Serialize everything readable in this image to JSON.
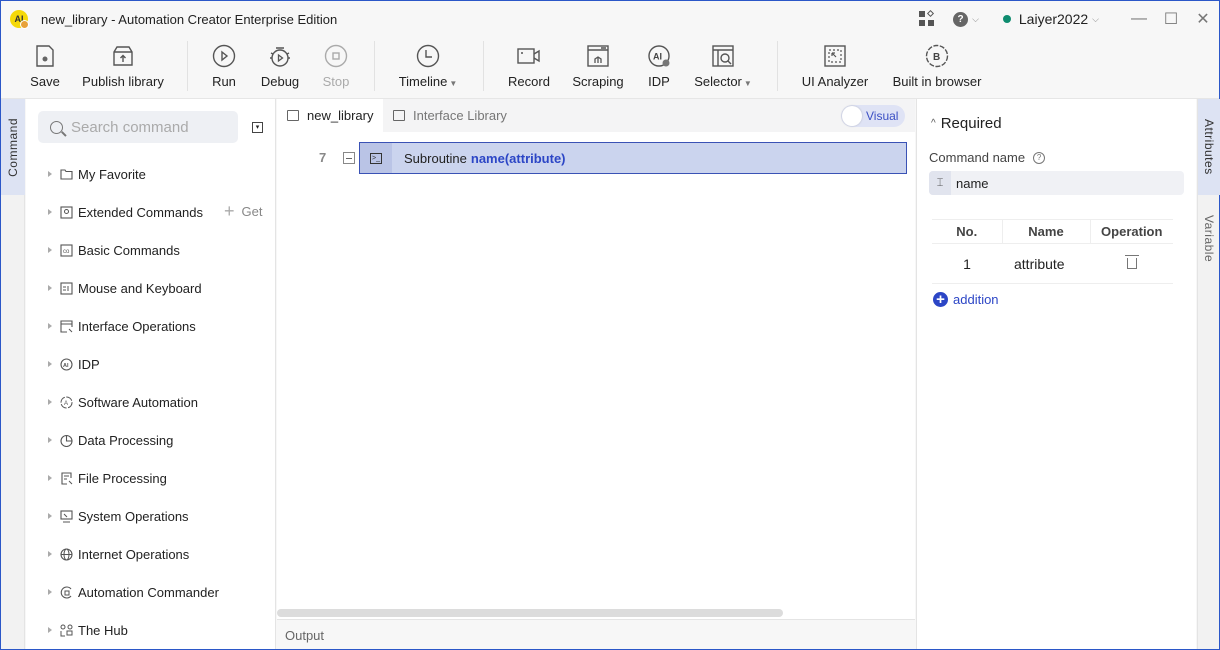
{
  "window": {
    "title": "new_library - Automation Creator Enterprise Edition",
    "logo_text": "AI",
    "user": "Laiyer2022",
    "user_status_color": "#0e8c6f",
    "help_glyph": "?",
    "minimize": "—",
    "maximize": "☐",
    "close": "✕"
  },
  "toolbar": {
    "save": "Save",
    "publish": "Publish library",
    "run": "Run",
    "debug": "Debug",
    "stop": "Stop",
    "timeline": "Timeline",
    "record": "Record",
    "scraping": "Scraping",
    "idp": "IDP",
    "selector": "Selector",
    "ui_analyzer": "UI Analyzer",
    "browser": "Built in browser"
  },
  "left_rail": {
    "command_tab": "Command"
  },
  "command_panel": {
    "search_placeholder": "Search command",
    "get_label": "Get",
    "items": [
      {
        "label": "My Favorite",
        "icon": "folder-icon"
      },
      {
        "label": "Extended Commands",
        "icon": "extension-icon"
      },
      {
        "label": "Basic Commands",
        "icon": "code-icon"
      },
      {
        "label": "Mouse and Keyboard",
        "icon": "keyboard-icon"
      },
      {
        "label": "Interface Operations",
        "icon": "window-icon"
      },
      {
        "label": "IDP",
        "icon": "ai-icon"
      },
      {
        "label": "Software Automation",
        "icon": "automation-icon"
      },
      {
        "label": "Data Processing",
        "icon": "pie-icon"
      },
      {
        "label": "File Processing",
        "icon": "file-icon"
      },
      {
        "label": "System Operations",
        "icon": "monitor-icon"
      },
      {
        "label": "Internet Operations",
        "icon": "globe-icon"
      },
      {
        "label": "Automation Commander",
        "icon": "commander-icon"
      },
      {
        "label": "The Hub",
        "icon": "hub-icon"
      }
    ]
  },
  "editor": {
    "tabs": [
      {
        "label": "new_library",
        "active": true
      },
      {
        "label": "Interface Library",
        "active": false
      }
    ],
    "visual_toggle": "Visual",
    "line_number": "7",
    "code_keyword": "Subroutine",
    "code_signature": "name(attribute)",
    "output_label": "Output"
  },
  "properties": {
    "section": "Required",
    "command_name_label": "Command name",
    "command_name_value": "name",
    "table_headers": [
      "No.",
      "Name",
      "Operation"
    ],
    "rows": [
      {
        "no": "1",
        "name": "attribute"
      }
    ],
    "add_label": "addition"
  },
  "right_rail": {
    "attributes_tab": "Attributes",
    "variable_tab": "Variable"
  }
}
